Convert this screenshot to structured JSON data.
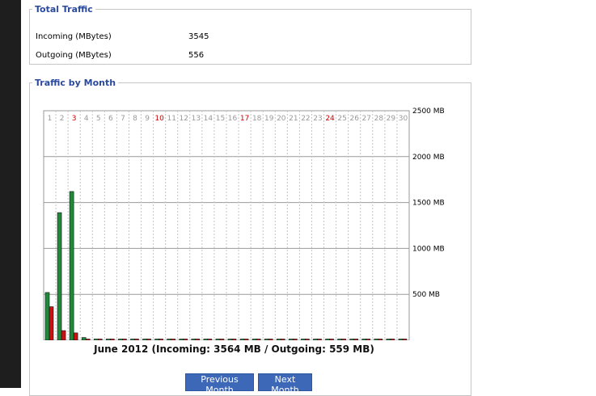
{
  "total_traffic": {
    "title": "Total Traffic",
    "incoming_label": "Incoming (MBytes)",
    "incoming_value": "3545",
    "outgoing_label": "Outgoing (MBytes)",
    "outgoing_value": "556"
  },
  "traffic_by_month": {
    "title": "Traffic by Month",
    "caption": "June 2012 (Incoming: 3564 MB / Outgoing: 559 MB)",
    "prev_label": "Previous Month",
    "next_label": "Next Month"
  },
  "chart_data": {
    "type": "bar",
    "categories": [
      "1",
      "2",
      "3",
      "4",
      "5",
      "6",
      "7",
      "8",
      "9",
      "10",
      "11",
      "12",
      "13",
      "14",
      "15",
      "16",
      "17",
      "18",
      "19",
      "20",
      "21",
      "22",
      "23",
      "24",
      "25",
      "26",
      "27",
      "28",
      "29",
      "30"
    ],
    "weekend_days": [
      "3",
      "10",
      "17",
      "24"
    ],
    "y_ticks": [
      "500 MB",
      "1000 MB",
      "1500 MB",
      "2000 MB",
      "2500 MB"
    ],
    "ylim": [
      0,
      2500
    ],
    "series": [
      {
        "values": [
          520,
          1390,
          1620,
          30,
          0,
          0,
          0,
          0,
          0,
          0,
          0,
          0,
          0,
          0,
          0,
          0,
          0,
          0,
          0,
          0,
          0,
          0,
          0,
          0,
          0,
          0,
          0,
          0,
          0,
          0
        ],
        "color": "#1f8a3a"
      },
      {
        "values": [
          365,
          105,
          80,
          8,
          0,
          0,
          0,
          0,
          0,
          0,
          0,
          0,
          0,
          0,
          0,
          0,
          0,
          0,
          0,
          0,
          0,
          0,
          0,
          0,
          0,
          0,
          0,
          0,
          0,
          0
        ],
        "color": "#cc1111"
      }
    ],
    "normal_label_color": "#999999",
    "weekend_label_color": "#cc0000",
    "grid": true
  }
}
